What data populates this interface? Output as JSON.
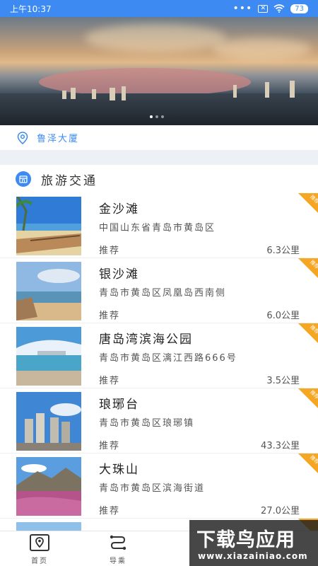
{
  "status_bar": {
    "time": "上午10:37",
    "signal": "•••",
    "sim": "✕",
    "battery": "73"
  },
  "location": {
    "text": "鲁泽大厦",
    "icon": "location-pin-icon"
  },
  "section": {
    "title": "旅游交通",
    "icon": "shop-icon"
  },
  "items": [
    {
      "name": "金沙滩",
      "address": "中国山东省青岛市黄岛区",
      "tag": "推荐",
      "distance": "6.3公里",
      "ribbon": "推荐"
    },
    {
      "name": "银沙滩",
      "address": "青岛市黄岛区凤凰岛西南侧",
      "tag": "推荐",
      "distance": "6.0公里",
      "ribbon": "推荐"
    },
    {
      "name": "唐岛湾滨海公园",
      "address": "青岛市黄岛区漓江西路666号",
      "tag": "推荐",
      "distance": "3.5公里",
      "ribbon": "推荐"
    },
    {
      "name": "琅琊台",
      "address": "青岛市黄岛区琅琊镇",
      "tag": "推荐",
      "distance": "43.3公里",
      "ribbon": "推荐"
    },
    {
      "name": "大珠山",
      "address": "青岛市黄岛区滨海街道",
      "tag": "推荐",
      "distance": "27.0公里",
      "ribbon": "推荐"
    }
  ],
  "nav": {
    "home": "首页",
    "guide": "导乘"
  },
  "watermark": {
    "main": "下载鸟应用",
    "sub": "www.xiazainiao.com"
  },
  "colors": {
    "accent": "#3d8bf2",
    "ribbon": "#f5a623"
  }
}
